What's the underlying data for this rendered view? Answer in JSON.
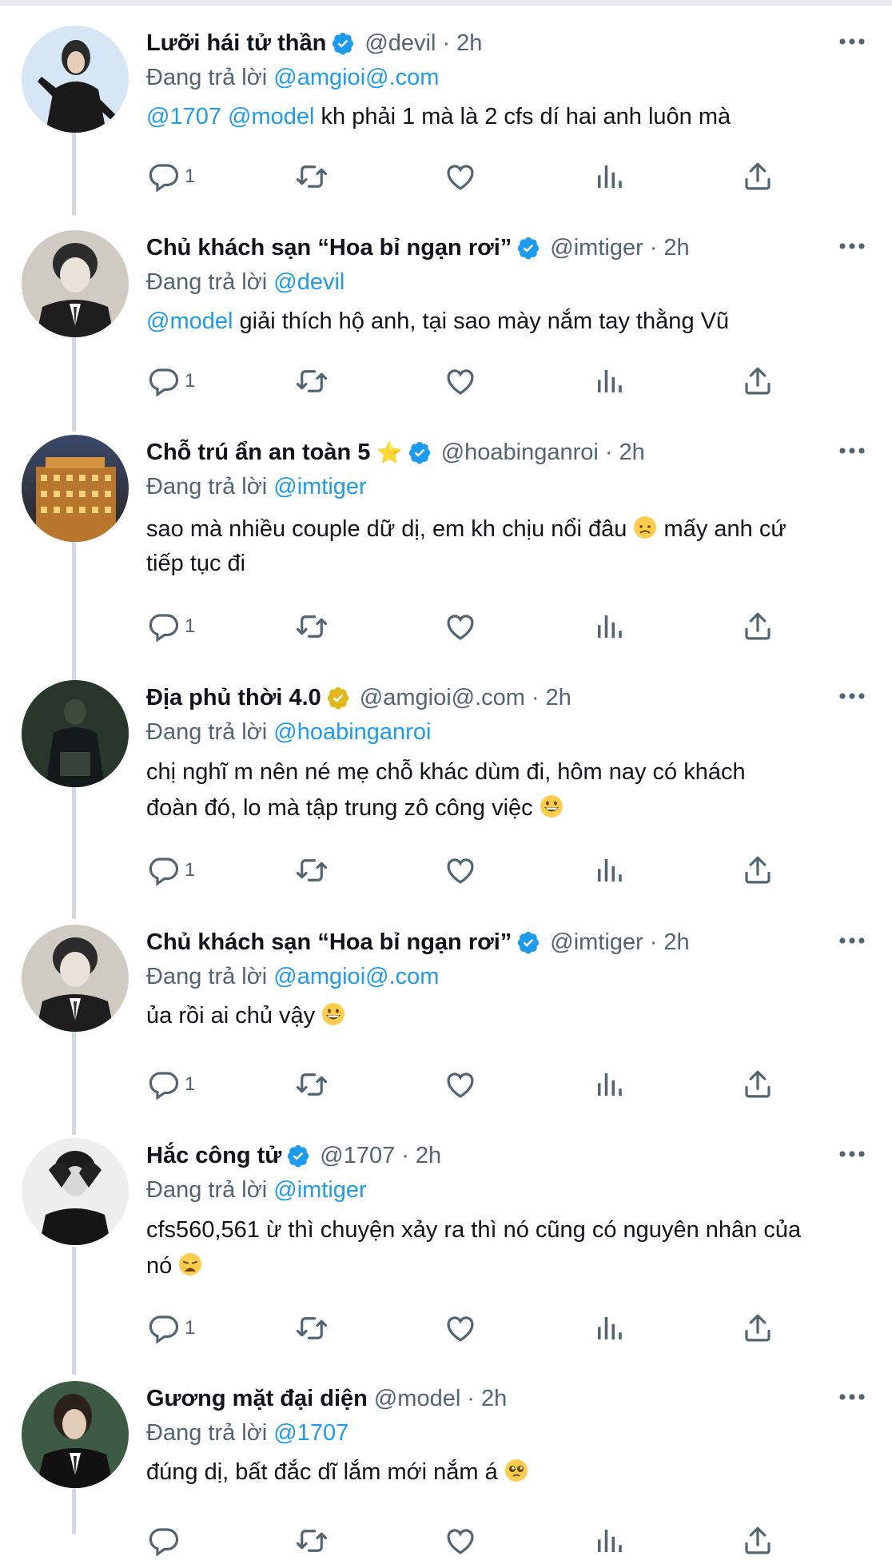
{
  "colors": {
    "link": "#1d9bf0",
    "muted": "#536471",
    "verified_blue": "#1d9bf0",
    "verified_gold": "#e2b719"
  },
  "replying_prefix": "Đang trả lời",
  "tweets": [
    {
      "name": "Lưỡi hái tử thần",
      "badge": "verified-blue",
      "handle": "@devil",
      "time": "2h",
      "reply_to": "@amgioi@.com",
      "text_mentions": [
        "@1707",
        "@model"
      ],
      "text": "kh phải 1 mà là 2 cfs dí hai anh luôn mà",
      "reply_count": "1"
    },
    {
      "name": "Chủ khách sạn “Hoa bỉ ngạn rơi”",
      "badge": "verified-blue",
      "handle": "@imtiger",
      "time": "2h",
      "reply_to": "@devil",
      "text_mentions": [
        "@model"
      ],
      "text": "giải thích hộ anh, tại sao mày nắm tay thằng Vũ",
      "reply_count": "1"
    },
    {
      "name": "Chỗ trú ẩn an toàn 5",
      "name_emoji": "star-emoji",
      "badge": "verified-blue",
      "handle": "@hoabinganroi",
      "time": "2h",
      "reply_to": "@imtiger",
      "text_line1": "sao mà nhiều couple dữ dị, em kh chịu nổi đâu",
      "text_emoji": "disappointed-face-emoji",
      "text_after": "mấy anh cứ",
      "text_line2": "tiếp tục đi",
      "reply_count": "1"
    },
    {
      "name": "Địa phủ thời 4.0",
      "badge": "verified-gold",
      "handle": "@amgioi@.com",
      "time": "2h",
      "reply_to": "@hoabinganroi",
      "text_line1": "chị nghĩ m nên né mẹ chỗ khác dùm đi, hôm nay có khách",
      "text_line2": "đoàn đó, lo mà tập trung zô công việc",
      "text_emoji": "grinning-face-emoji",
      "reply_count": "1"
    },
    {
      "name": "Chủ khách sạn “Hoa bỉ ngạn rơi”",
      "badge": "verified-blue",
      "handle": "@imtiger",
      "time": "2h",
      "reply_to": "@amgioi@.com",
      "text": "ủa rồi ai chủ vậy",
      "text_emoji": "grinning-face-emoji",
      "reply_count": "1"
    },
    {
      "name": "Hắc công tử",
      "badge": "verified-blue",
      "handle": "@1707",
      "time": "2h",
      "reply_to": "@imtiger",
      "text_line1": "cfs560,561 ừ thì chuyện xảy ra thì nó cũng có nguyên nhân của",
      "text_line2": "nó",
      "text_emoji": "weary-face-emoji",
      "reply_count": "1"
    },
    {
      "name": "Gương mặt đại diện",
      "badge": "none",
      "handle": "@model",
      "time": "2h",
      "reply_to": "@1707",
      "text": "đúng dị, bất đắc dĩ lắm mới nắm á",
      "text_emoji": "pleading-face-emoji",
      "reply_count": ""
    }
  ]
}
